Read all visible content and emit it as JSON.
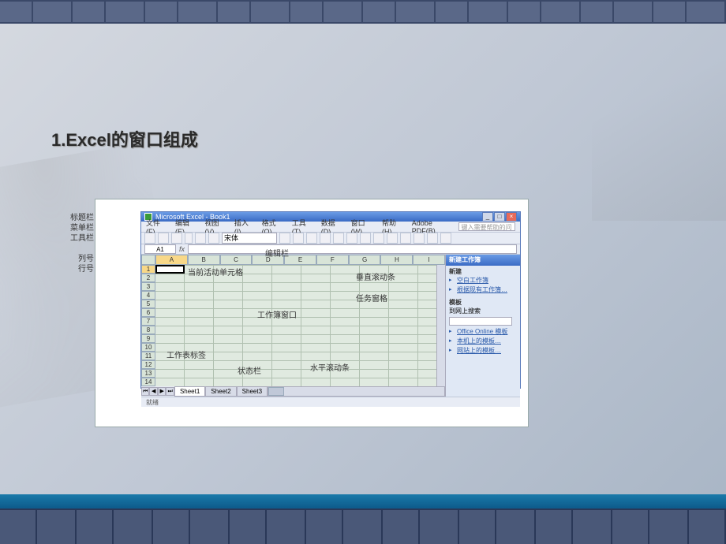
{
  "slide": {
    "title": "1.Excel的窗口组成"
  },
  "labels": {
    "titlebar": "标题栏",
    "menubar": "菜单栏",
    "toolbar": "工具栏",
    "colheader": "列号",
    "rowheader": "行号",
    "formulabar": "编辑栏",
    "activecell": "当前活动单元格",
    "vscroll": "垂直滚动条",
    "taskpane": "任务窗格",
    "workarea": "工作簿窗口",
    "sheettab": "工作表标签",
    "statusbar": "状态栏",
    "hscroll": "水平滚动条"
  },
  "excel": {
    "title": "Microsoft Excel - Book1",
    "namebox": "A1",
    "fx": "fx",
    "font": "宋体",
    "helpPlaceholder": "键入需要帮助的问题",
    "status": "就绪",
    "menus": [
      "文件(F)",
      "编辑(E)",
      "视图(V)",
      "插入(I)",
      "格式(O)",
      "工具(T)",
      "数据(D)",
      "窗口(W)",
      "帮助(H)",
      "Adobe PDF(B)"
    ],
    "columns": [
      "A",
      "B",
      "C",
      "D",
      "E",
      "F",
      "G",
      "H",
      "I"
    ],
    "rows": [
      "1",
      "2",
      "3",
      "4",
      "5",
      "6",
      "7",
      "8",
      "9",
      "10",
      "11",
      "12",
      "13",
      "14"
    ],
    "sheets": [
      "Sheet1",
      "Sheet2",
      "Sheet3"
    ],
    "taskpane": {
      "header": "新建工作簿",
      "section1": "新建",
      "blankWorkbook": "空白工作簿",
      "fromExisting": "根据现有工作簿…",
      "section2": "模板",
      "searchLabel": "到网上搜索",
      "officeOnline": "Office Online 模板",
      "localTemplates": "本机上的模板…",
      "webTemplates": "网站上的模板…"
    }
  }
}
